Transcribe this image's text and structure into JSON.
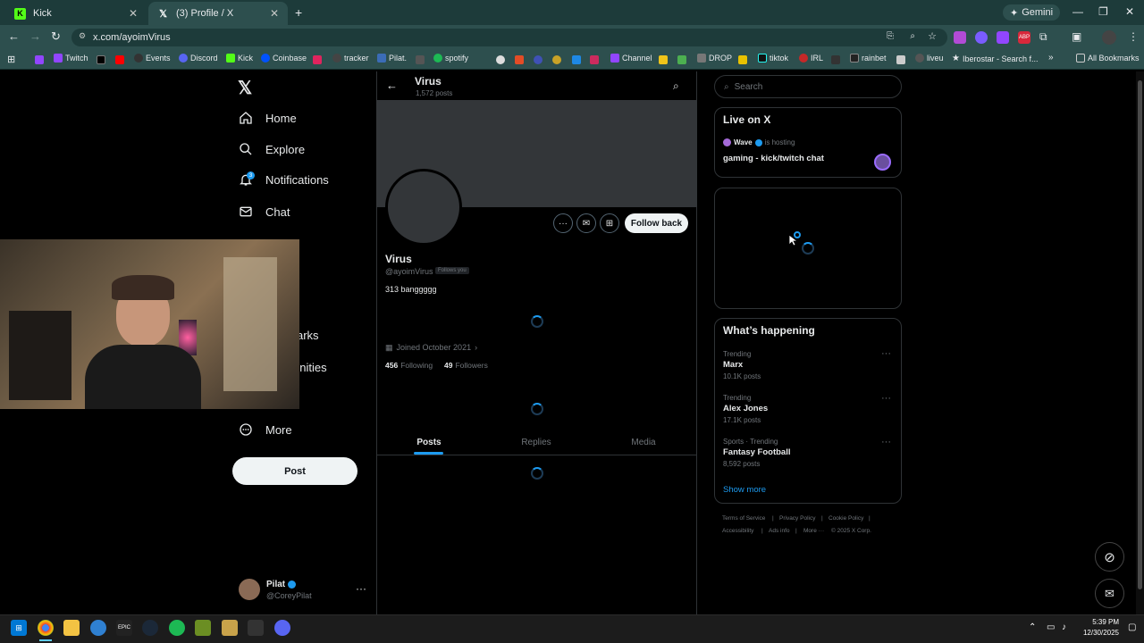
{
  "browser": {
    "tabs": [
      {
        "title": "Kick"
      },
      {
        "title": "(3) Profile / X"
      }
    ],
    "gemini_label": "Gemini",
    "url": "x.com/ayoimVirus",
    "bookmarks": [
      "Twitch",
      "Events",
      "Discord",
      "Kick",
      "Coinbase",
      "tracker",
      "Pilat.",
      "spotify",
      "Channel",
      "DROP",
      "tiktok",
      "IRL",
      "rainbet",
      "liveu",
      "Iberostar - Search f..."
    ],
    "all_bookmarks_label": "All Bookmarks"
  },
  "leftnav": {
    "items": [
      "Home",
      "Explore",
      "Notifications",
      "Chat"
    ],
    "partial_items": [
      "arks",
      "unities"
    ],
    "more_label": "More",
    "post_label": "Post",
    "notification_badge": "3",
    "account": {
      "name": "Pilat",
      "handle": "@CoreyPilat"
    }
  },
  "profile": {
    "header_name": "Virus",
    "header_posts": "1,572 posts",
    "name": "Virus",
    "handle": "@ayoimVirus",
    "follows_you": "Follows you",
    "bio": "313 banggggg",
    "joined": "Joined October 2021",
    "following_count": "456",
    "following_label": "Following",
    "followers_count": "49",
    "followers_label": "Followers",
    "follow_back_label": "Follow back",
    "tabs": [
      "Posts",
      "Replies",
      "Media"
    ],
    "active_tab": "Posts"
  },
  "right": {
    "search_placeholder": "Search",
    "live": {
      "title": "Live on X",
      "host": "Wave",
      "hosting_text": "is hosting",
      "stream_title": "gaming - kick/twitch chat"
    },
    "whats_happening": {
      "title": "What’s happening",
      "trends": [
        {
          "context": "Trending",
          "name": "Marx",
          "posts": "10.1K posts"
        },
        {
          "context": "Trending",
          "name": "Alex Jones",
          "posts": "17.1K posts"
        },
        {
          "context": "Sports · Trending",
          "name": "Fantasy Football",
          "posts": "8,592 posts"
        }
      ],
      "show_more": "Show more"
    },
    "footer": [
      "Terms of Service",
      "Privacy Policy",
      "Cookie Policy",
      "Accessibility",
      "Ads info",
      "More ···",
      "© 2025 X Corp."
    ]
  },
  "taskbar": {
    "time": "5:39 PM",
    "date": "12/30/2025"
  }
}
